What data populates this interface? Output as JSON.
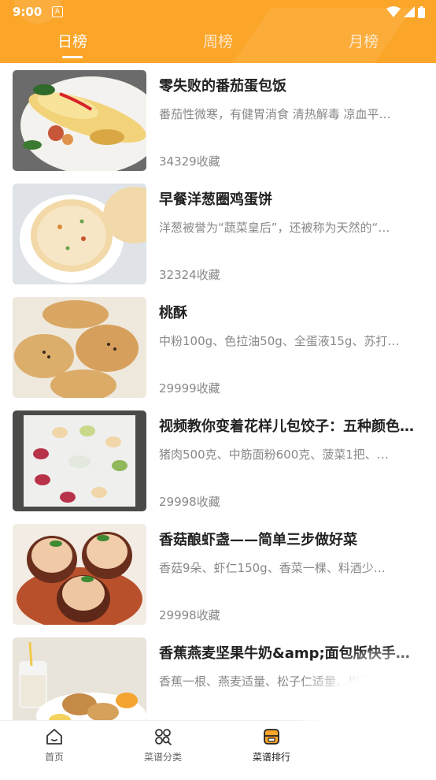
{
  "status_bar": {
    "time": "9:00",
    "notification_icon": "A"
  },
  "tabs": [
    {
      "label": "日榜"
    },
    {
      "label": "周榜"
    },
    {
      "label": "月榜"
    }
  ],
  "recipes": [
    {
      "title": "零失败的番茄蛋包饭",
      "desc": "番茄性微寒，有健胃消食 清热解毒 凉血平…",
      "favorites": "34329收藏"
    },
    {
      "title": "早餐洋葱圈鸡蛋饼",
      "desc": "洋葱被誉为“蔬菜皇后”，还被称为天然的“…",
      "favorites": "32324收藏"
    },
    {
      "title": "桃酥",
      "desc": "中粉100g、色拉油50g、全蛋液15g、苏打…",
      "favorites": "29999收藏"
    },
    {
      "title": "视频教你变着花样儿包饺子：五种颜色…",
      "desc": "猪肉500克、中筋面粉600克、菠菜1把、…",
      "favorites": "29998收藏"
    },
    {
      "title": "香菇酿虾盏——简单三步做好菜",
      "desc": "香菇9朵、虾仁150g、香菜一棵、料酒少…",
      "favorites": "29998收藏"
    },
    {
      "title": "香蕉燕麦坚果牛奶&amp;面包版快手早餐",
      "desc": "香蕉一根、燕麦适量、松子仁适量、枸杞…",
      "favorites": ""
    }
  ],
  "bottom_nav": [
    {
      "label": "首页",
      "icon": "home-icon"
    },
    {
      "label": "菜谱分类",
      "icon": "category-icon"
    },
    {
      "label": "菜谱排行",
      "icon": "ranking-icon"
    },
    {
      "label": "",
      "icon": ""
    }
  ],
  "colors": {
    "accent": "#FBA529",
    "title": "#222222",
    "secondary": "#888888"
  }
}
